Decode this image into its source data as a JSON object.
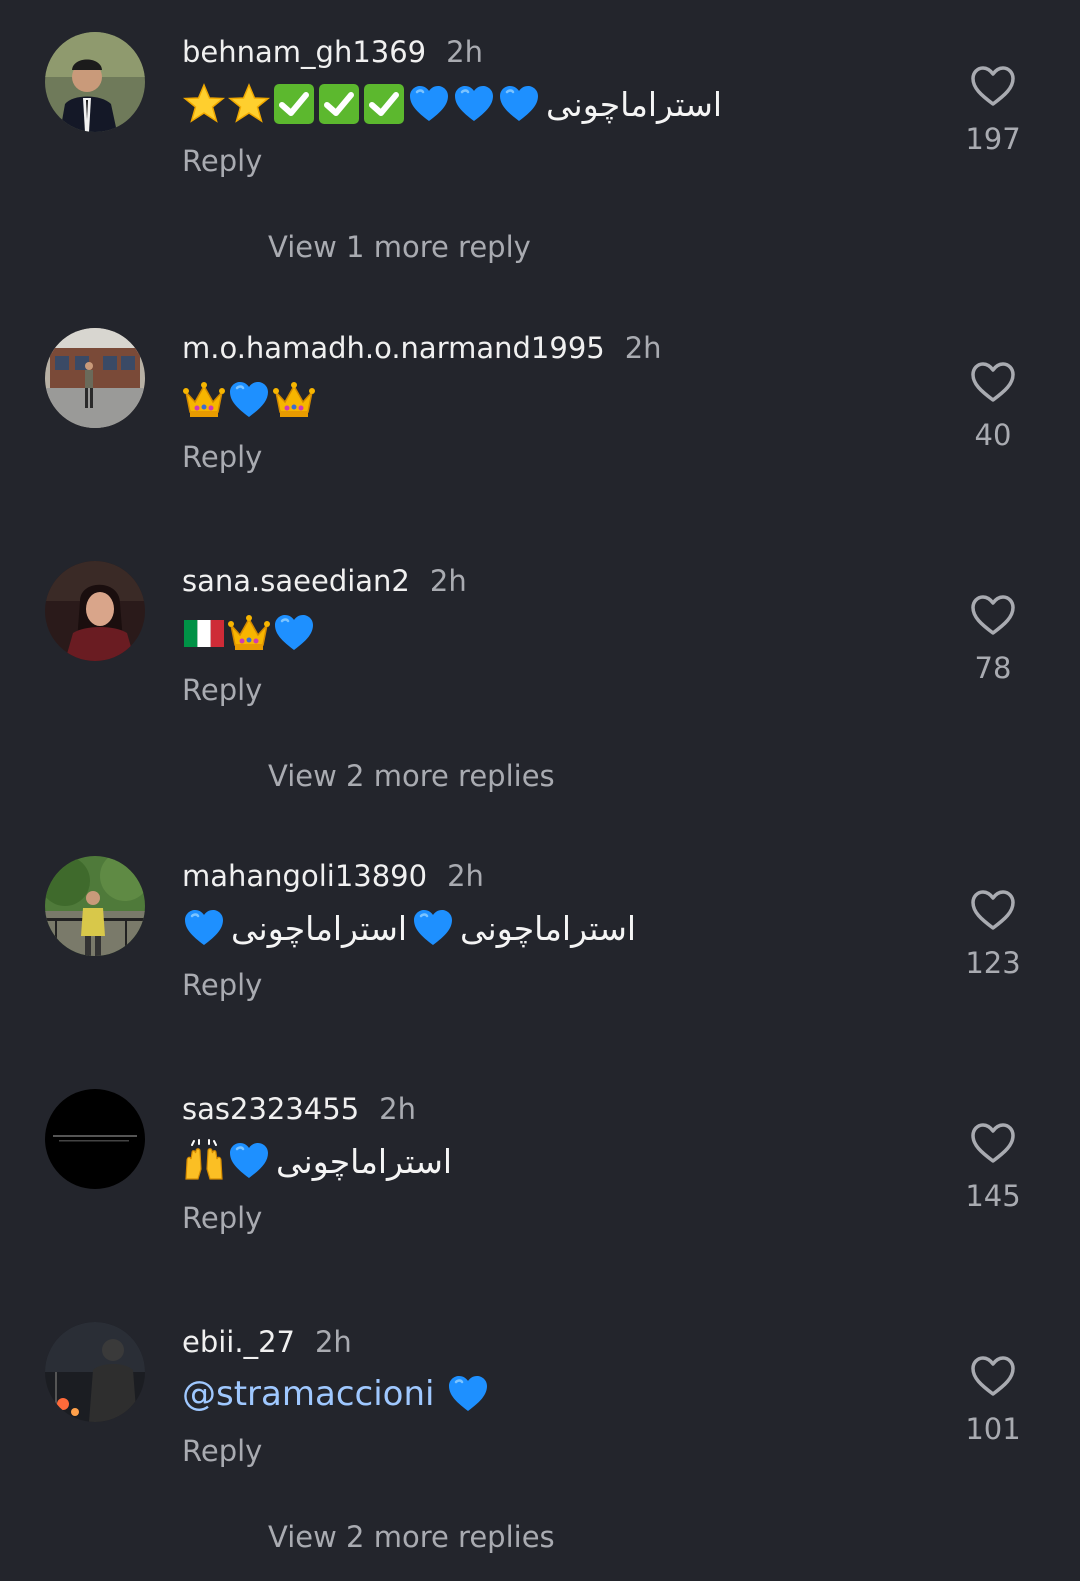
{
  "comments": [
    {
      "username": "behnam_gh1369",
      "time": "2h",
      "text": "استراماچونی",
      "reply_label": "Reply",
      "likes": "197",
      "view_more": "View 1 more reply"
    },
    {
      "username": "m.o.hamadh.o.narmand1995",
      "time": "2h",
      "reply_label": "Reply",
      "likes": "40"
    },
    {
      "username": "sana.saeedian2",
      "time": "2h",
      "reply_label": "Reply",
      "likes": "78",
      "view_more": "View 2 more replies"
    },
    {
      "username": "mahangoli13890",
      "time": "2h",
      "text_a": "استراماچونی",
      "text_b": "استراماچونی",
      "reply_label": "Reply",
      "likes": "123"
    },
    {
      "username": "sas2323455",
      "time": "2h",
      "text": "استراماچونی",
      "reply_label": "Reply",
      "likes": "145"
    },
    {
      "username": "ebii._27",
      "time": "2h",
      "mention": "@stramaccioni",
      "reply_label": "Reply",
      "likes": "101",
      "view_more": "View 2 more replies"
    }
  ],
  "colors": {
    "background": "#23252c",
    "username": "#f0f0f0",
    "secondary": "#a9abb1",
    "mention": "#9fc8ff",
    "heart_emoji": "#1e90ff"
  },
  "icons": {
    "like": "heart-outline-icon",
    "emoji_heart": "blue-heart-emoji",
    "emoji_star": "star-emoji",
    "emoji_check": "check-mark-button-emoji",
    "emoji_crown": "crown-emoji",
    "emoji_flag": "italy-flag-emoji",
    "emoji_hands": "raising-hands-emoji"
  }
}
